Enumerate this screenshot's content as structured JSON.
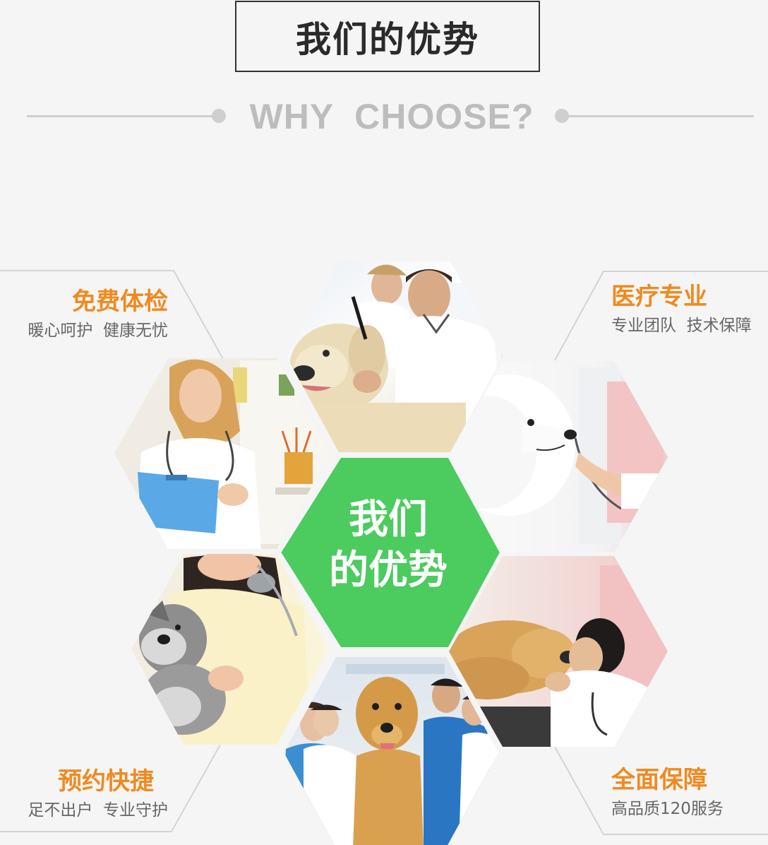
{
  "header": {
    "title": "我们的优势",
    "subtitle": "WHY  CHOOSE?"
  },
  "center": {
    "line1": "我们",
    "line2": "的优势",
    "color": "#4ccb5f"
  },
  "features": {
    "checkup": {
      "title": "免费体检",
      "subtitle": "暖心呵护  健康无忧"
    },
    "medical": {
      "title": "医疗专业",
      "subtitle": "专业团队  技术保障"
    },
    "booking": {
      "title": "预约快捷",
      "subtitle": "足不出户  专业守护"
    },
    "guarantee": {
      "title": "全面保障",
      "subtitle": "高品质120服务"
    }
  },
  "colors": {
    "accent_orange": "#f08a1f",
    "center_green": "#4ccb5f",
    "background": "#f5f5f5",
    "divider_gray": "#cfcfcf"
  },
  "photos": {
    "top": "vet-examining-labrador-photo",
    "upper_left": "female-vet-clipboard-photo",
    "upper_right": "white-dog-stethoscope-photo",
    "lower_left": "woman-holding-schnauzer-photo",
    "lower_right": "vet-with-golden-retriever-photo",
    "bottom": "vet-team-golden-retriever-photo"
  }
}
